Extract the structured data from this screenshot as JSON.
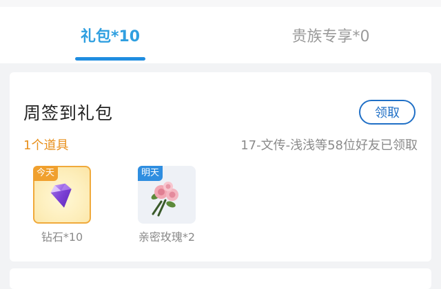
{
  "tabs": [
    {
      "label": "礼包*10",
      "active": true
    },
    {
      "label": "贵族专享*0",
      "active": false
    }
  ],
  "card": {
    "title": "周签到礼包",
    "claim_label": "领取",
    "item_count": "1个道具",
    "claimed_info": "17-文传-浅浅等58位好友已领取",
    "gifts": [
      {
        "badge": "今天",
        "label": "钻石*10",
        "icon": "purple-diamond-icon"
      },
      {
        "badge": "明天",
        "label": "亲密玫瑰*2",
        "icon": "rose-bouquet-icon"
      }
    ]
  },
  "colors": {
    "accent": "#2f9fe0",
    "underline": "#1f8de0",
    "button": "#1f6fc6",
    "orange": "#e8901c",
    "today_badge": "#f0a02e",
    "tomorrow_badge": "#2f8ee0"
  }
}
